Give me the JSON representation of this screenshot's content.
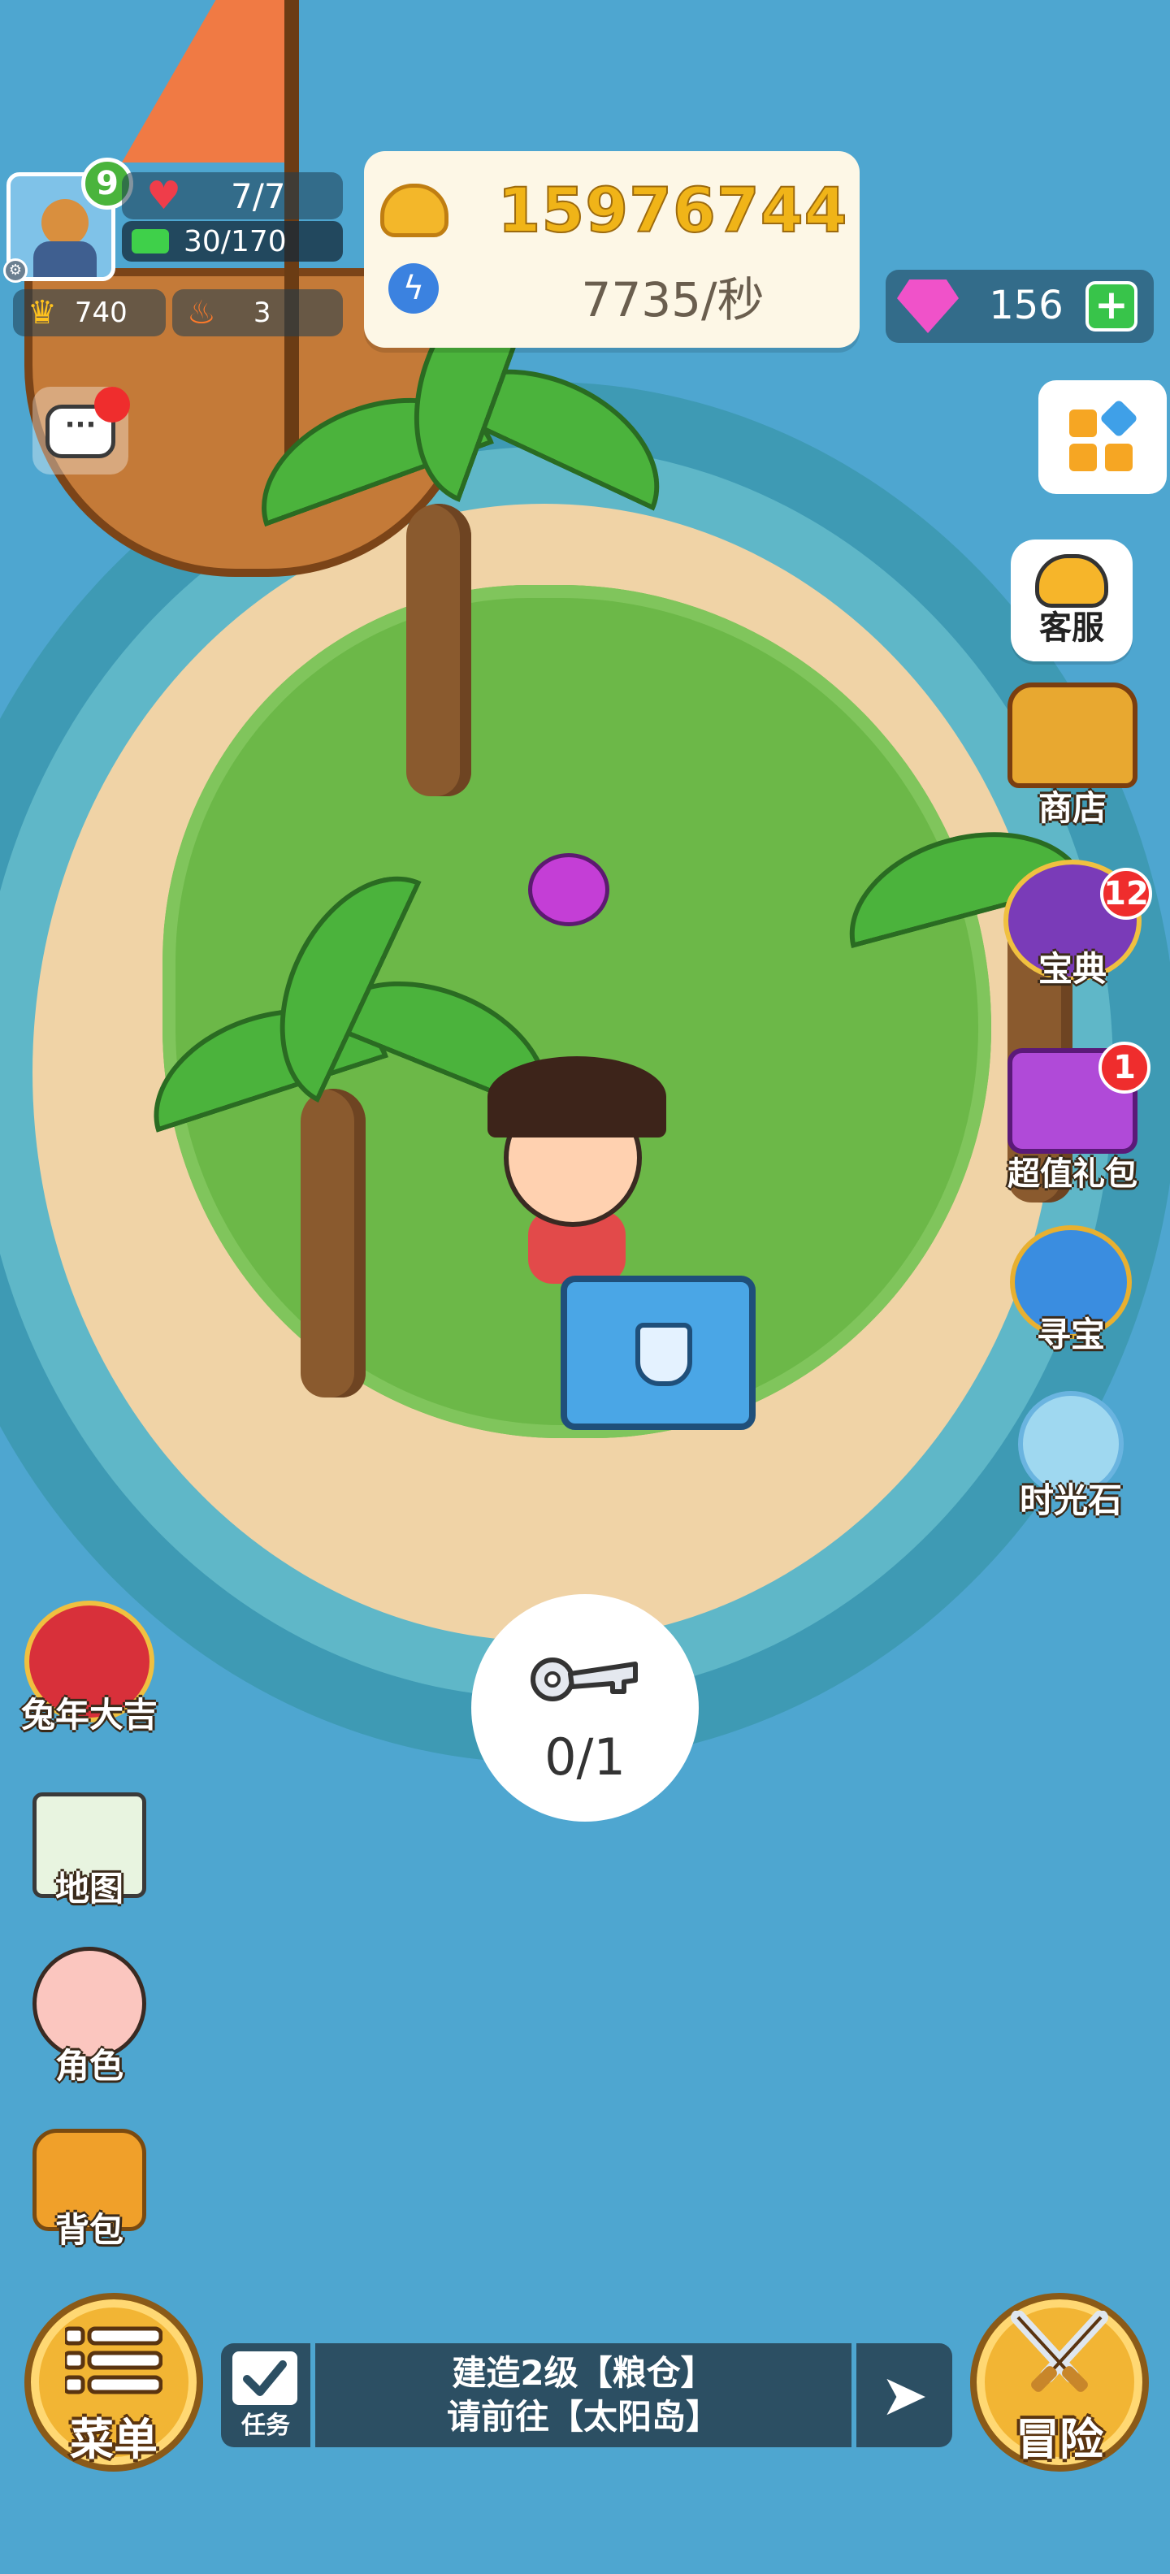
{
  "player": {
    "level": "9",
    "hp": "7/7",
    "energy": "30/170",
    "crowns": "740",
    "fire": "3"
  },
  "resources": {
    "coins": "15976744",
    "rate": "7735/秒",
    "gems": "156"
  },
  "right_menu": {
    "kefu": "客服",
    "shop": "商店",
    "codex": "宝典",
    "codex_badge": "12",
    "gift": "超值礼包",
    "gift_badge": "1",
    "treasure": "寻宝",
    "timestone": "时光石"
  },
  "left_menu": {
    "event": "兔年大吉",
    "map": "地图",
    "character": "角色",
    "bag": "背包"
  },
  "key": {
    "count": "0/1"
  },
  "bottom": {
    "menu": "菜单",
    "task": "任务",
    "quest_line1": "建造2级【粮仓】",
    "quest_line2": "请前往【太阳岛】",
    "adventure": "冒险"
  },
  "colors": {
    "sea": "#4ea6d0",
    "sand": "#f0d3a6",
    "grass": "#6cb848",
    "coin": "#f0b418",
    "gem": "#f052c9",
    "badge": "#ef2d2d",
    "quest_bar": "#2c4f63"
  },
  "icons": {
    "hp": "heart-icon",
    "energy": "energy-bar-icon",
    "crowns": "crown-icon",
    "fire": "fire-icon",
    "coins": "coin-stack-icon",
    "rate": "lightning-icon",
    "gems": "gem-icon",
    "add": "plus-icon",
    "chat": "chat-icon",
    "apps": "grid-icon",
    "kefu": "headset-icon",
    "key": "key-icon",
    "menu": "list-icon",
    "task": "clipboard-icon",
    "go": "arrow-right-icon",
    "adventure": "crossed-swords-icon"
  }
}
